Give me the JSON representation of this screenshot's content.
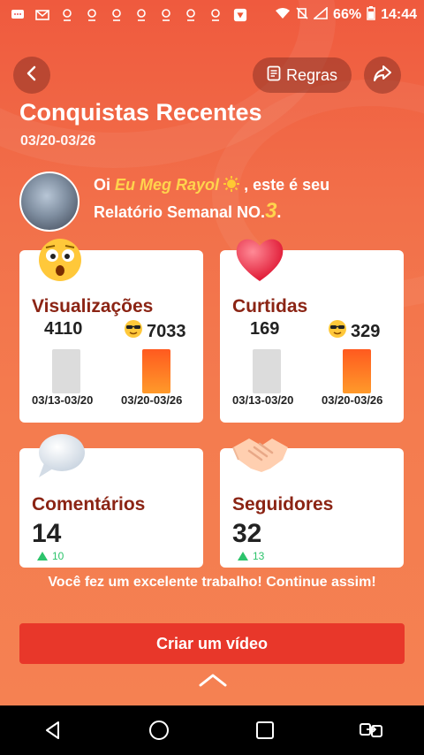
{
  "status_bar": {
    "battery": "66%",
    "time": "14:44",
    "left_icons": [
      "message-icon",
      "mail-icon",
      "eye-icon",
      "eye-icon",
      "eye-icon",
      "eye-icon",
      "eye-icon",
      "eye-icon",
      "eye-icon",
      "app-icon"
    ]
  },
  "header": {
    "rules_label": "Regras",
    "title": "Conquistas Recentes",
    "date_range": "03/20-03/26"
  },
  "greeting": {
    "prefix": "Oi ",
    "name": "Eu Meg Rayol",
    "middle": ", este é seu",
    "line2": "Relatório Semanal NO.",
    "number": "3",
    "suffix": "."
  },
  "cards": {
    "views": {
      "title": "Visualizações",
      "prev_value": "4110",
      "cur_value": "7033",
      "prev_label": "03/13-03/20",
      "cur_label": "03/20-03/26"
    },
    "likes": {
      "title": "Curtidas",
      "prev_value": "169",
      "cur_value": "329",
      "prev_label": "03/13-03/20",
      "cur_label": "03/20-03/26"
    },
    "comments": {
      "title": "Comentários",
      "value": "14",
      "growth": "10"
    },
    "followers": {
      "title": "Seguidores",
      "value": "32",
      "growth": "13"
    }
  },
  "footer_message": "Você fez um excelente trabalho! Continue assim!",
  "cta_label": "Criar um vídeo",
  "colors": {
    "accent": "#e8372a",
    "card_title": "#8b2414",
    "highlight": "#ffd44d",
    "growth": "#2cc36b"
  }
}
